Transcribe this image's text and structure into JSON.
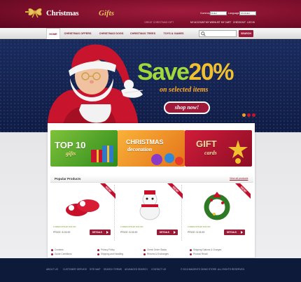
{
  "header": {
    "logo_main": "Christmas",
    "logo_accent": "Gifts",
    "slogan": "GREAT CHRISTMAS GIFT",
    "currency_label": "Currency:",
    "currency_value": "Dollar",
    "language_label": "Language:",
    "language_value": "US Dollar",
    "account_links": [
      "MY ACCOUNT",
      "MY WISHLIST",
      "MY CART",
      "CHECKOUT",
      "LOG IN"
    ]
  },
  "nav": {
    "items": [
      "HOME",
      "CHRISTMAS OFFERS",
      "CHRISTMAS DOGS",
      "CHRISTMAS TREES",
      "TOYS & GAMES"
    ],
    "search_button": "SEARCH"
  },
  "banner": {
    "headline_a": "Save",
    "headline_b": "20%",
    "subline": "on selected items",
    "cta": "shop now!"
  },
  "promos": [
    {
      "line1": "TOP 10",
      "line2": "gifts"
    },
    {
      "line1": "CHRISTMAS",
      "line2": "decoration"
    },
    {
      "line1": "GIFT",
      "line2": "cards"
    }
  ],
  "popular": {
    "title": "Popular Products",
    "view_all": "View all products",
    "products": [
      {
        "badge": "NEW!",
        "name": "LOREM IPSUM DOLOR",
        "price": "PRICE: $ 26.99",
        "details": "DETAILS"
      },
      {
        "badge": "NEW!",
        "name": "LOREM IPSUM DOLOR",
        "price": "PRICE: $ 26.99",
        "details": "DETAILS"
      },
      {
        "badge": "NEW!",
        "name": "LOREM IPSUM DOLOR",
        "price": "PRICE: $ 26.99",
        "details": "DETAILS"
      }
    ]
  },
  "info_links": {
    "col1": [
      "Contents",
      "Guide Conditions"
    ],
    "col2": [
      "Privacy Policy",
      "Shipping and Handling"
    ],
    "col3": [
      "Check Order Status",
      "Returns & Exchanges"
    ],
    "col4": [
      "Shipping Options & Charges",
      "Product Recall"
    ]
  },
  "footer": {
    "links": [
      "ABOUT US",
      "CUSTOMER SERVICE",
      "SITE MAP",
      "SEARCH TERMS",
      "ADVANCED SEARCH",
      "CONTACT US"
    ],
    "copyright": "© 2010 MAGENTO DEMO STORE. ALL RIGHTS RESERVED."
  },
  "colors": {
    "brand_red": "#9a1b38",
    "navy": "#1a2b5e",
    "green": "#9fd93a",
    "gold": "#f0c030"
  }
}
